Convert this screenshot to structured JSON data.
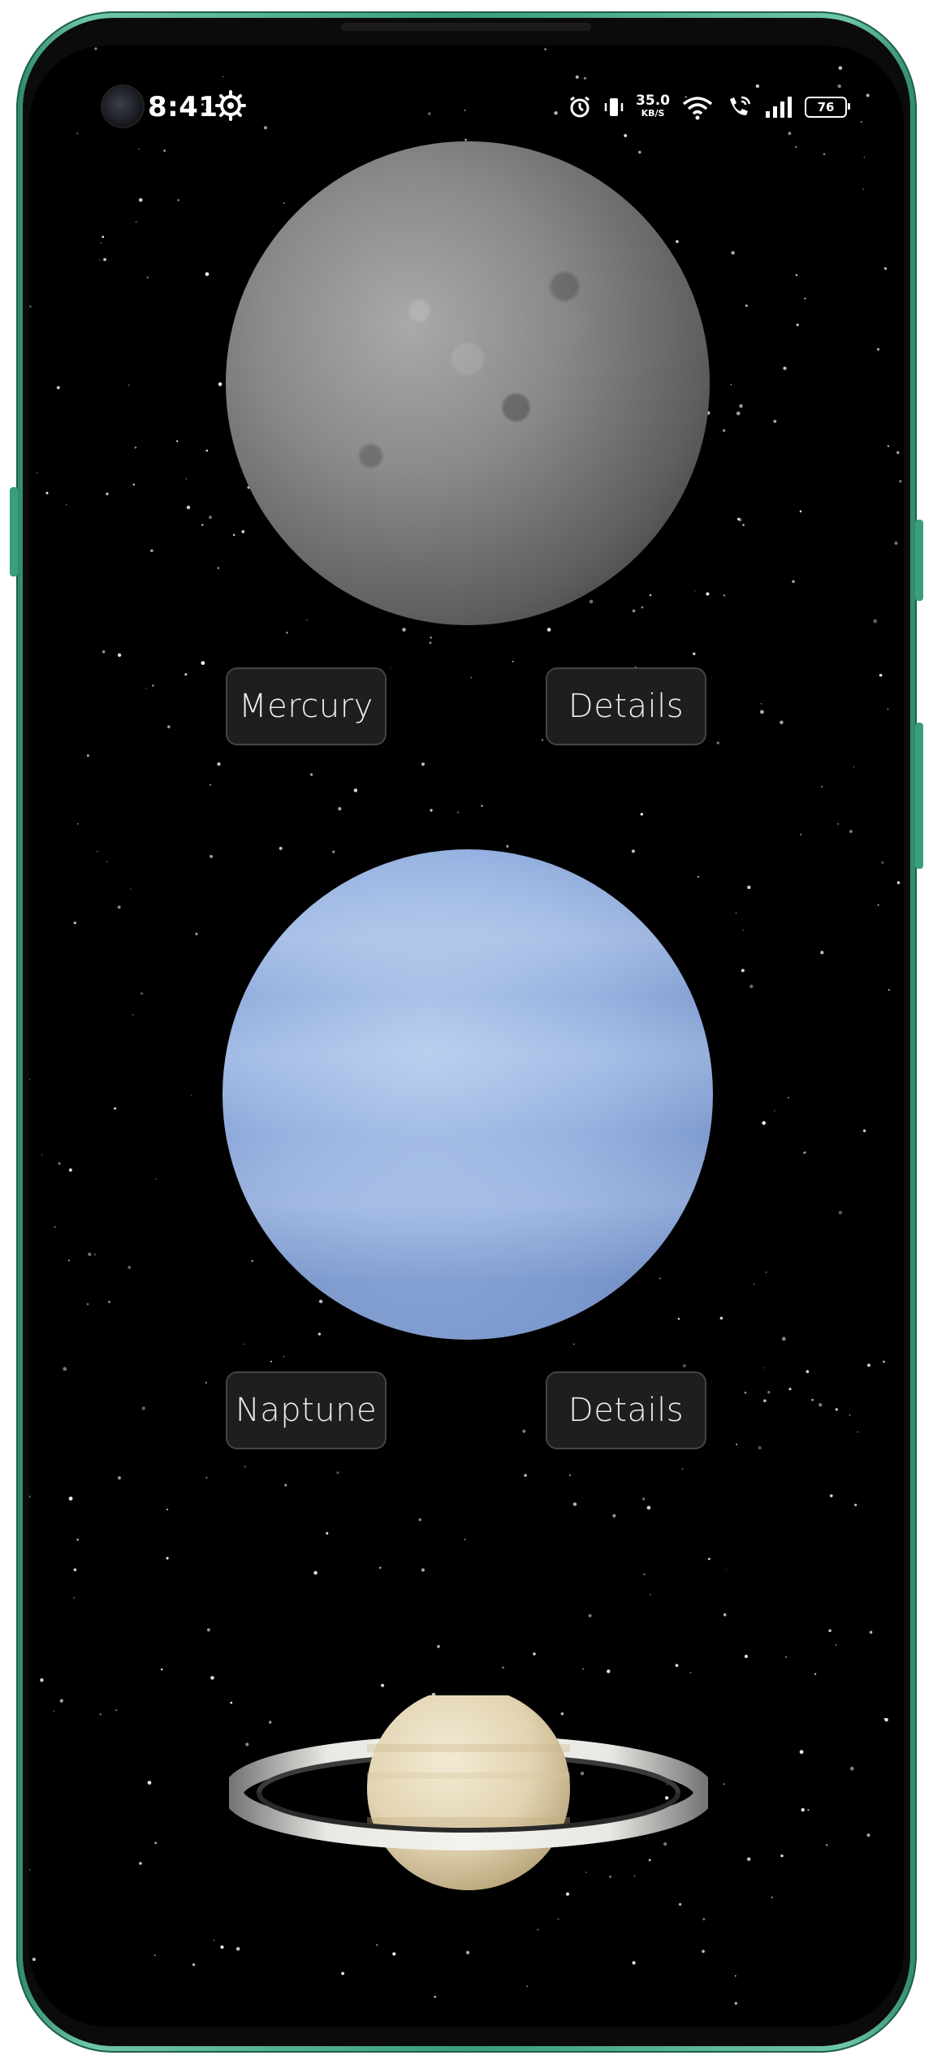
{
  "status_bar": {
    "time": "8:41",
    "network_speed": "35.0",
    "network_speed_unit": "KB/S",
    "battery": "76",
    "icons": [
      "settings-gear-icon",
      "alarm-icon",
      "vibrate-icon",
      "wifi-icon",
      "wifi-calling-icon",
      "signal-icon",
      "battery-icon"
    ]
  },
  "planets": [
    {
      "name_label": "Mercury",
      "details_label": "Details",
      "color": "#8a8a8a"
    },
    {
      "name_label": "Naptune",
      "details_label": "Details",
      "color": "#98b4e2"
    },
    {
      "color": "#e8dcc0"
    }
  ],
  "colors": {
    "frame": "#3a9d7c",
    "background": "#000000",
    "button_bg": "#1e1e1e",
    "button_text": "#ececec"
  }
}
